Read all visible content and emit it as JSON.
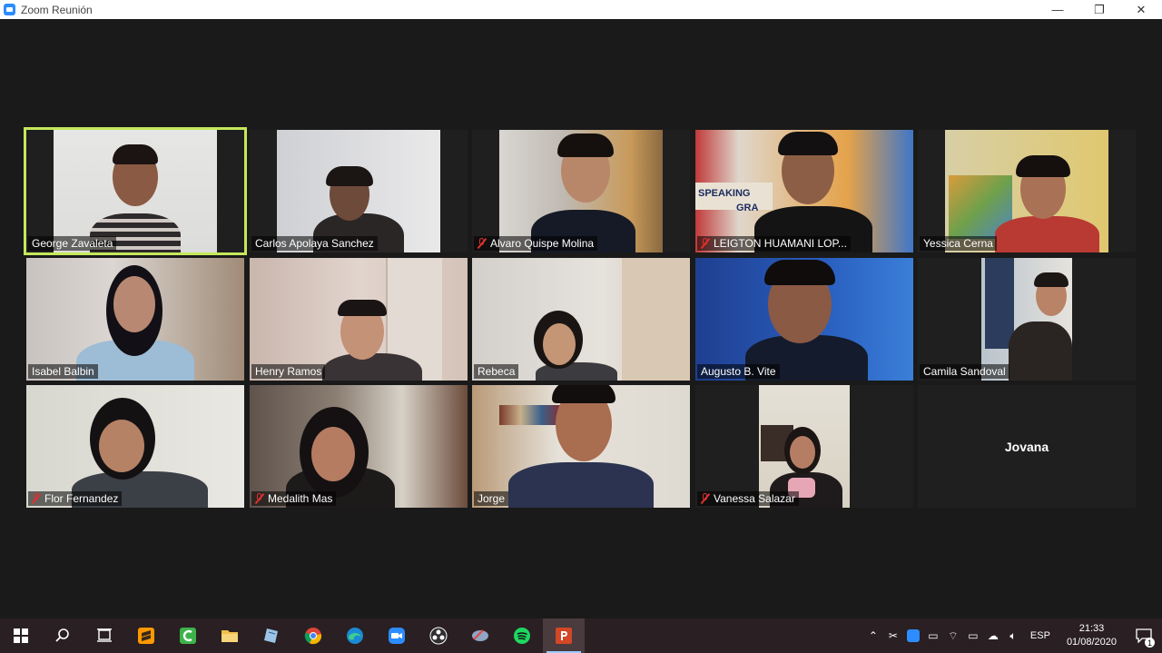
{
  "window": {
    "title": "Zoom Reunión",
    "minimize": "—",
    "restore": "❐",
    "close": "✕"
  },
  "participants": [
    {
      "name": "George Zavaleta",
      "muted": false,
      "active": true
    },
    {
      "name": "Carlos Apolaya Sanchez",
      "muted": false
    },
    {
      "name": "Alvaro Quispe Molina",
      "muted": true
    },
    {
      "name": "LEIGTON HUAMANI LOP...",
      "muted": true
    },
    {
      "name": "Yessica Cerna",
      "muted": false
    },
    {
      "name": "Isabel Balbin",
      "muted": false
    },
    {
      "name": "Henry Ramos",
      "muted": false
    },
    {
      "name": "Rebeca",
      "muted": false
    },
    {
      "name": "Augusto B. Vite",
      "muted": false
    },
    {
      "name": "Camila Sandoval",
      "muted": false
    },
    {
      "name": "Flor Fernandez",
      "muted": true
    },
    {
      "name": "Medalith Mas",
      "muted": true
    },
    {
      "name": "Jorge",
      "muted": false
    },
    {
      "name": "Vanessa Salazar",
      "muted": true
    },
    {
      "name": "Jovana",
      "muted": false,
      "video_off": true
    }
  ],
  "tile_content": {
    "speaking_sign": "SPEAKING",
    "speaking_sign_2": "GRA"
  },
  "taskbar": {
    "apps": [
      "windows-start",
      "search",
      "task-view",
      "sublime-text",
      "camtasia",
      "file-explorer",
      "notes",
      "chrome",
      "edge",
      "zoom",
      "obs",
      "snip",
      "spotify",
      "powerpoint"
    ],
    "active_app": "powerpoint",
    "language": "ESP",
    "time": "21:33",
    "date": "01/08/2020",
    "notification_count": "1"
  },
  "colors": {
    "active_speaker_border": "#c6e85b",
    "mute_red": "#e0312d",
    "zoom_blue": "#2d8cff"
  }
}
